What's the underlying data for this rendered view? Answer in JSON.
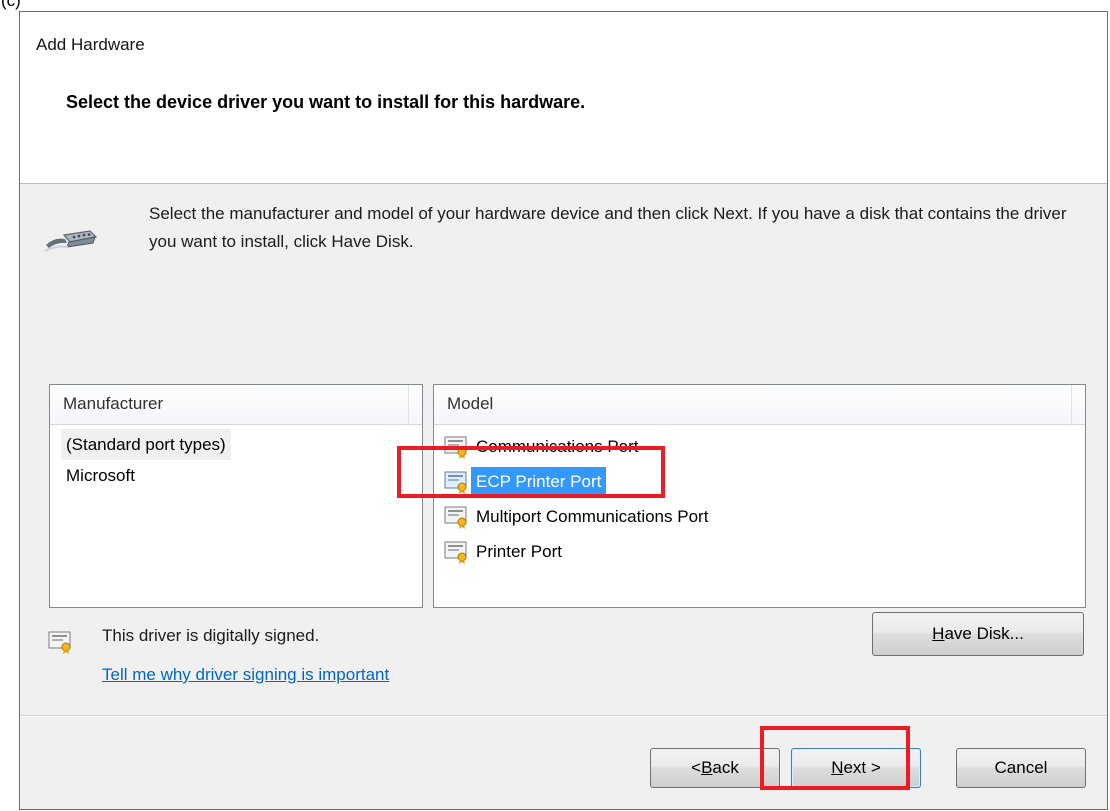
{
  "page": {
    "caption": "(c)"
  },
  "dialog": {
    "title": "Add Hardware",
    "heading": "Select the device driver you want to install for this hardware.",
    "instructions": "Select the manufacturer and model of your hardware device and then click Next. If you have a disk that contains the driver you want to install, click Have Disk."
  },
  "manufacturer": {
    "header": "Manufacturer",
    "items": [
      {
        "label": "(Standard port types)",
        "selected": true
      },
      {
        "label": "Microsoft",
        "selected": false
      }
    ]
  },
  "model": {
    "header": "Model",
    "items": [
      {
        "label": "Communications Port",
        "selected": false,
        "icon": "certificate-icon"
      },
      {
        "label": "ECP Printer Port",
        "selected": true,
        "icon": "certificate-icon"
      },
      {
        "label": "Multiport Communications Port",
        "selected": false,
        "icon": "certificate-icon"
      },
      {
        "label": "Printer Port",
        "selected": false,
        "icon": "certificate-icon"
      }
    ]
  },
  "signing": {
    "status": "This driver is digitally signed.",
    "link": "Tell me why driver signing is important",
    "icon": "certificate-icon"
  },
  "buttons": {
    "have_disk": {
      "mnemonic": "H",
      "rest": "ave Disk..."
    },
    "back": {
      "prefix": "< ",
      "mnemonic": "B",
      "rest": "ack"
    },
    "next": {
      "mnemonic": "N",
      "rest": "ext >"
    },
    "cancel": {
      "label": "Cancel"
    }
  },
  "theme": {
    "dialog_background": "#f0f0f0",
    "selection_blue": "#3399ff",
    "link_blue": "#0066cc",
    "highlight_red": "#ed1c24"
  },
  "icons": {
    "hardware": "serial-port-cable-icon"
  }
}
